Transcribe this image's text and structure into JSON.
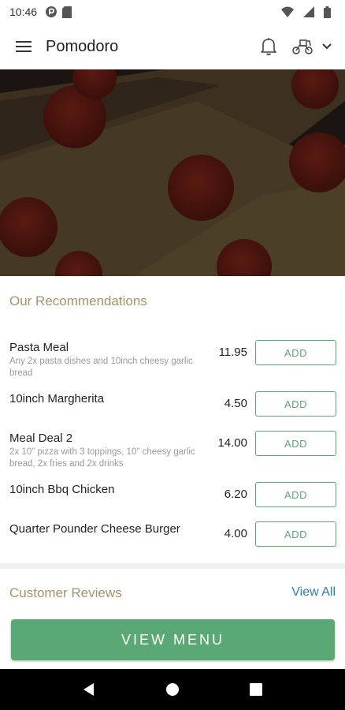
{
  "status_bar": {
    "time": "10:46",
    "icons_left": [
      "data-saver-icon",
      "sim-card-icon"
    ],
    "icons_right": [
      "wifi-icon",
      "signal-icon",
      "battery-icon"
    ]
  },
  "app_bar": {
    "title": "Pomodoro",
    "icons": [
      "menu-icon",
      "bell-icon",
      "scooter-delivery-icon",
      "chevron-down-icon"
    ]
  },
  "hero": {
    "image": "pepperoni-pizza-photo"
  },
  "recommendations": {
    "title": "Our Recommendations",
    "add_label": "ADD",
    "items": [
      {
        "name": "Pasta Meal",
        "desc": "Any 2x pasta dishes and 10inch cheesy garlic bread",
        "price": "11.95"
      },
      {
        "name": "10inch Margherita",
        "desc": "",
        "price": "4.50"
      },
      {
        "name": "Meal Deal 2",
        "desc": "2x 10\" pizza with 3 toppings, 10\" cheesy garlic bread, 2x fries and 2x drinks",
        "price": "14.00"
      },
      {
        "name": "10inch Bbq Chicken",
        "desc": "",
        "price": "6.20"
      },
      {
        "name": "Quarter Pounder Cheese Burger",
        "desc": "",
        "price": "4.00"
      }
    ]
  },
  "reviews": {
    "title": "Customer Reviews",
    "view_all": "View All"
  },
  "cta": {
    "label": "VIEW MENU"
  },
  "nav": {
    "icons": [
      "back-icon",
      "home-icon",
      "recents-icon"
    ]
  },
  "colors": {
    "accent_green": "#5aa873",
    "section_gold": "#a5926a",
    "link_blue": "#2a7db8"
  }
}
